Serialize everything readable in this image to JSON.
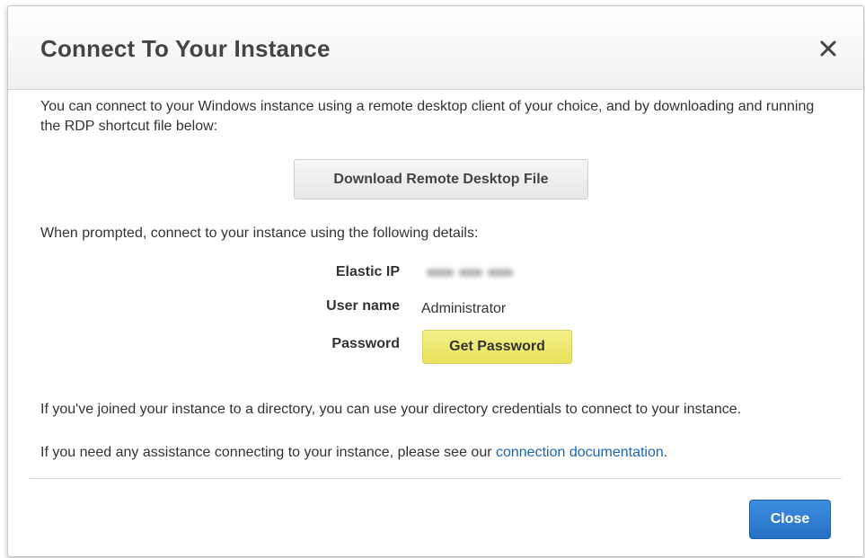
{
  "dialog": {
    "title": "Connect To Your Instance",
    "close_icon": "close-icon"
  },
  "intro": {
    "text": "You can connect to your Windows instance using a remote desktop client of your choice, and by downloading and running the RDP shortcut file below:"
  },
  "download_button": {
    "label": "Download Remote Desktop File"
  },
  "prompt": {
    "text": "When prompted, connect to your instance using the following details:"
  },
  "details": {
    "elastic_ip": {
      "label": "Elastic IP"
    },
    "user_name": {
      "label": "User name",
      "value": "Administrator"
    },
    "password": {
      "label": "Password",
      "button_label": "Get Password"
    }
  },
  "footer_text": {
    "directory": "If you've joined your instance to a directory, you can use your directory credentials to connect to your instance.",
    "assist_prefix": "If you need any assistance connecting to your instance, please see our ",
    "assist_link": "connection documentation",
    "assist_suffix": "."
  },
  "close_button": {
    "label": "Close"
  },
  "colors": {
    "primary_button": "#2a74c9",
    "highlight_button": "#ede86c",
    "link": "#1a66b3"
  }
}
